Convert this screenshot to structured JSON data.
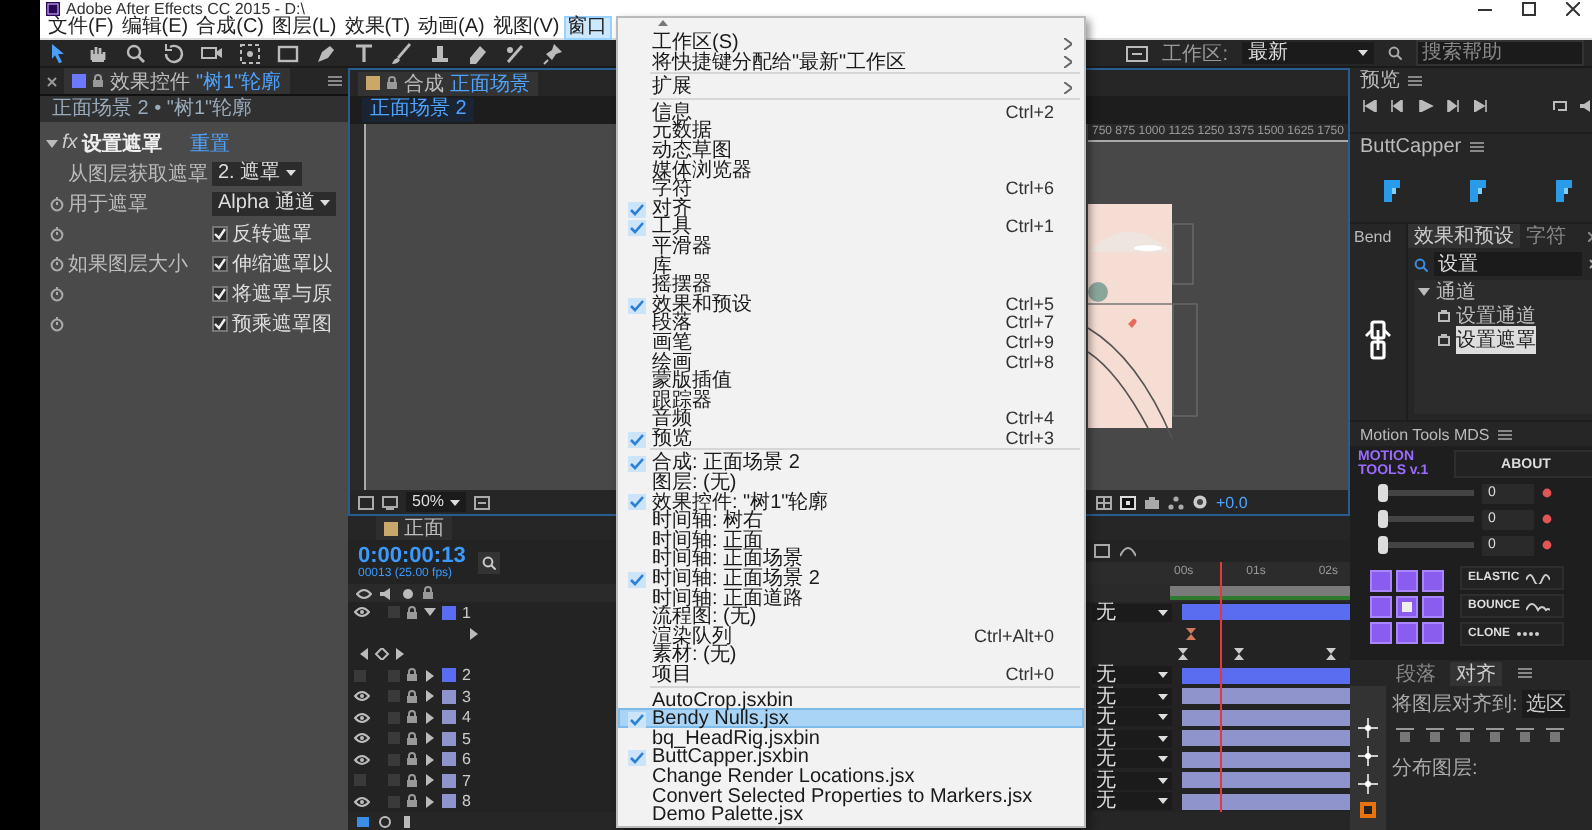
{
  "window": {
    "title": "Adobe After Effects CC 2015 - D:\\"
  },
  "menu_bar": [
    {
      "label": "文件(F)",
      "selected": false
    },
    {
      "label": "编辑(E)",
      "selected": false
    },
    {
      "label": "合成(C)",
      "selected": false
    },
    {
      "label": "图层(L)",
      "selected": false
    },
    {
      "label": "效果(T)",
      "selected": false
    },
    {
      "label": "动画(A)",
      "selected": false
    },
    {
      "label": "视图(V)",
      "selected": false
    },
    {
      "label": "窗口",
      "selected": true
    }
  ],
  "toolbar": {
    "workspace_label": "工作区:",
    "workspace": "最新",
    "search_placeholder": "搜索帮助"
  },
  "effect_controls": {
    "tab_label": "效果控件",
    "tab_layer": "\"树1\"轮廓",
    "breadcrumb": "正面场景 2 • \"树1\"轮廓",
    "effect": {
      "fx": "fx",
      "name": "设置遮罩",
      "reset": "重置",
      "expanded": true
    },
    "properties": [
      {
        "kind": "dropdown",
        "label": "从图层获取遮罩",
        "value": "2. 遮罩",
        "stopwatch": false
      },
      {
        "kind": "dropdown",
        "label": "用于遮罩",
        "value": "Alpha 通道",
        "stopwatch": true
      },
      {
        "kind": "checkbox",
        "text": "反转遮罩",
        "checked": true,
        "stopwatch": true
      },
      {
        "kind": "checkbox",
        "label": "如果图层大小",
        "text": "伸缩遮罩以",
        "checked": true,
        "stopwatch": true
      },
      {
        "kind": "checkbox",
        "text": "将遮罩与原",
        "checked": true,
        "stopwatch": true
      },
      {
        "kind": "checkbox",
        "text": "预乘遮罩图",
        "checked": true,
        "stopwatch": true
      }
    ]
  },
  "composition": {
    "tab_label": "合成",
    "tab_name": "正面场景",
    "view_tab": "正面场景 2",
    "ruler_labels": [
      "750",
      "875",
      "1000",
      "1125",
      "1250",
      "1375",
      "1500",
      "1625",
      "1750"
    ],
    "zoom": "50%",
    "exposure": "+0.0"
  },
  "timeline": {
    "tab": "正面",
    "timecode": "0:00:00:13",
    "frame_info": "00013 (25.00 fps)",
    "time_labels": [
      "00s",
      "01s",
      "02s"
    ],
    "layers": [
      {
        "number": "1",
        "visible": true,
        "expanded": true,
        "color": "#5a6cf0",
        "parent": "无"
      },
      {
        "number": "2",
        "visible": false,
        "expanded": false,
        "color": "#5a6cf0",
        "parent": "无"
      },
      {
        "number": "3",
        "visible": true,
        "expanded": false,
        "color": "#8f94cc",
        "parent": "无"
      },
      {
        "number": "4",
        "visible": true,
        "expanded": false,
        "color": "#8f94cc",
        "parent": "无"
      },
      {
        "number": "5",
        "visible": true,
        "expanded": false,
        "color": "#8f94cc",
        "parent": "无"
      },
      {
        "number": "6",
        "visible": true,
        "expanded": false,
        "color": "#8f94cc",
        "parent": "无"
      },
      {
        "number": "7",
        "visible": false,
        "expanded": false,
        "color": "#8f94cc",
        "parent": "无"
      },
      {
        "number": "8",
        "visible": true,
        "expanded": false,
        "color": "#8f94cc",
        "parent": "无"
      }
    ]
  },
  "preview": {
    "title": "预览"
  },
  "buttcapper": {
    "title": "ButtCapper"
  },
  "bendy": {
    "tab": "Bend"
  },
  "effects_presets": {
    "tabs": [
      {
        "label": "效果和预设",
        "selected": true
      },
      {
        "label": "字符",
        "selected": false
      }
    ],
    "search": "设置",
    "tree": [
      {
        "label": "通道",
        "expanded": true,
        "selected": false,
        "children": [
          {
            "label": "设置通道",
            "selected": false
          },
          {
            "label": "设置遮罩",
            "selected": true
          }
        ]
      }
    ]
  },
  "motion_tools": {
    "title": "Motion Tools MDS",
    "logo": "MOTION TOOLS v.1",
    "about": "ABOUT",
    "sliders": [
      {
        "value": "0",
        "level": 0
      },
      {
        "value": "0",
        "level": 0
      },
      {
        "value": "0",
        "level": 0
      }
    ],
    "anchors": [
      {
        "selected": false
      },
      {
        "selected": false
      },
      {
        "selected": false
      },
      {
        "selected": false
      },
      {
        "selected": true
      },
      {
        "selected": false
      },
      {
        "selected": false
      },
      {
        "selected": false
      },
      {
        "selected": false
      }
    ],
    "modes": [
      {
        "label": "ELASTIC",
        "kind": "wave"
      },
      {
        "label": "BOUNCE",
        "kind": "bounce"
      },
      {
        "label": "CLONE",
        "kind": "dots"
      }
    ]
  },
  "align": {
    "tabs": [
      {
        "label": "段落",
        "selected": false
      },
      {
        "label": "对齐",
        "selected": true
      }
    ],
    "align_to_label": "将图层对齐到:",
    "align_to": "选区",
    "distribute_label": "分布图层:"
  },
  "window_menu": {
    "sections": [
      [
        {
          "label": "工作区(S)",
          "checked": false,
          "submenu": true,
          "selected": false
        },
        {
          "label": "将快捷键分配给\"最新\"工作区",
          "checked": false,
          "submenu": true,
          "selected": false
        }
      ],
      [
        {
          "label": "扩展",
          "checked": false,
          "submenu": true,
          "selected": false
        }
      ],
      [
        {
          "label": "信息",
          "shortcut": "Ctrl+2",
          "checked": false,
          "submenu": false,
          "selected": false
        },
        {
          "label": "元数据",
          "checked": false,
          "submenu": false,
          "selected": false
        },
        {
          "label": "动态草图",
          "checked": false,
          "submenu": false,
          "selected": false
        },
        {
          "label": "媒体浏览器",
          "checked": false,
          "submenu": false,
          "selected": false
        },
        {
          "label": "字符",
          "shortcut": "Ctrl+6",
          "checked": false,
          "submenu": false,
          "selected": false
        },
        {
          "label": "对齐",
          "checked": true,
          "submenu": false,
          "selected": false
        },
        {
          "label": "工具",
          "shortcut": "Ctrl+1",
          "checked": true,
          "submenu": false,
          "selected": false
        },
        {
          "label": "平滑器",
          "checked": false,
          "submenu": false,
          "selected": false
        },
        {
          "label": "库",
          "checked": false,
          "submenu": false,
          "selected": false
        },
        {
          "label": "摇摆器",
          "checked": false,
          "submenu": false,
          "selected": false
        },
        {
          "label": "效果和预设",
          "shortcut": "Ctrl+5",
          "checked": true,
          "submenu": false,
          "selected": false
        },
        {
          "label": "段落",
          "shortcut": "Ctrl+7",
          "checked": false,
          "submenu": false,
          "selected": false
        },
        {
          "label": "画笔",
          "shortcut": "Ctrl+9",
          "checked": false,
          "submenu": false,
          "selected": false
        },
        {
          "label": "绘画",
          "shortcut": "Ctrl+8",
          "checked": false,
          "submenu": false,
          "selected": false
        },
        {
          "label": "蒙版插值",
          "checked": false,
          "submenu": false,
          "selected": false
        },
        {
          "label": "跟踪器",
          "checked": false,
          "submenu": false,
          "selected": false
        },
        {
          "label": "音频",
          "shortcut": "Ctrl+4",
          "checked": false,
          "submenu": false,
          "selected": false
        },
        {
          "label": "预览",
          "shortcut": "Ctrl+3",
          "checked": true,
          "submenu": false,
          "selected": false
        }
      ],
      [
        {
          "label": "合成: 正面场景 2",
          "checked": true,
          "submenu": false,
          "selected": false
        },
        {
          "label": "图层: (无)",
          "checked": false,
          "submenu": false,
          "selected": false
        },
        {
          "label": "效果控件: \"树1\"轮廓",
          "checked": true,
          "submenu": false,
          "selected": false
        },
        {
          "label": "时间轴: 树右",
          "checked": false,
          "submenu": false,
          "selected": false
        },
        {
          "label": "时间轴: 正面",
          "checked": false,
          "submenu": false,
          "selected": false
        },
        {
          "label": "时间轴: 正面场景",
          "checked": false,
          "submenu": false,
          "selected": false
        },
        {
          "label": "时间轴: 正面场景 2",
          "checked": true,
          "submenu": false,
          "selected": false
        },
        {
          "label": "时间轴: 正面道路",
          "checked": false,
          "submenu": false,
          "selected": false
        },
        {
          "label": "流程图: (无)",
          "checked": false,
          "submenu": false,
          "selected": false
        },
        {
          "label": "渲染队列",
          "shortcut": "Ctrl+Alt+0",
          "checked": false,
          "submenu": false,
          "selected": false
        },
        {
          "label": "素材: (无)",
          "checked": false,
          "submenu": false,
          "selected": false
        },
        {
          "label": "项目",
          "shortcut": "Ctrl+0",
          "checked": false,
          "submenu": false,
          "selected": false
        }
      ],
      [
        {
          "label": "AutoCrop.jsxbin",
          "checked": false,
          "submenu": false,
          "selected": false
        },
        {
          "label": "Bendy Nulls.jsx",
          "checked": true,
          "submenu": false,
          "selected": true
        },
        {
          "label": "bq_HeadRig.jsxbin",
          "checked": false,
          "submenu": false,
          "selected": false
        },
        {
          "label": "ButtCapper.jsxbin",
          "checked": true,
          "submenu": false,
          "selected": false
        },
        {
          "label": "Change Render Locations.jsx",
          "checked": false,
          "submenu": false,
          "selected": false
        },
        {
          "label": "Convert Selected Properties to Markers.jsx",
          "checked": false,
          "submenu": false,
          "selected": false
        },
        {
          "label": "Demo Palette.jsx",
          "checked": false,
          "submenu": false,
          "selected": false
        }
      ]
    ]
  }
}
